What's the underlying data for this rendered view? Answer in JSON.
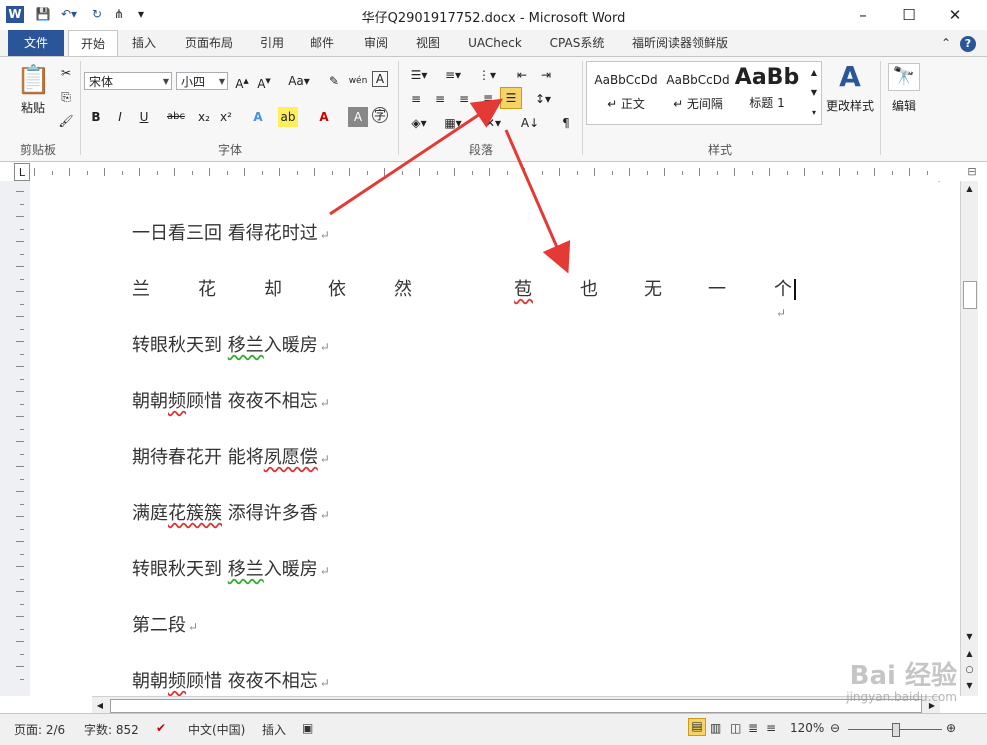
{
  "window": {
    "title": "华仔Q2901917752.docx - Microsoft Word",
    "app_icon": "W",
    "controls": {
      "help": "?"
    }
  },
  "tabs": [
    "文件",
    "开始",
    "插入",
    "页面布局",
    "引用",
    "邮件",
    "审阅",
    "视图",
    "UACheck",
    "CPAS系统",
    "福昕阅读器领鲜版"
  ],
  "active_tab": "开始",
  "ribbon": {
    "clipboard": {
      "paste": "粘贴",
      "group": "剪贴板"
    },
    "font": {
      "name": "宋体",
      "size": "小四",
      "group": "字体"
    },
    "paragraph": {
      "group": "段落"
    },
    "styles": {
      "items": [
        {
          "preview": "AaBbCcDd",
          "name": "↵ 正文"
        },
        {
          "preview": "AaBbCcDd",
          "name": "↵ 无间隔"
        },
        {
          "preview": "AaBb",
          "name": "标题 1"
        }
      ],
      "change_styles": "更改样式",
      "group": "样式"
    },
    "editing": {
      "label": "编辑"
    }
  },
  "document": {
    "lines": [
      {
        "text": "一日看三回  看得花时过"
      },
      {
        "text": "兰   花   却   依   然      苞   也   无   一   个"
      },
      {
        "text": "转眼秋天到  移兰入暖房"
      },
      {
        "text": "朝朝频顾惜  夜夜不相忘"
      },
      {
        "text": "期待春花开  能将夙愿偿"
      },
      {
        "text": "满庭花簇簇  添得许多香"
      },
      {
        "text": "转眼秋天到  移兰入暖房"
      },
      {
        "text": "第二段"
      },
      {
        "text": "朝朝频顾惜  夜夜不相忘"
      }
    ]
  },
  "status": {
    "page": "页面: 2/6",
    "words": "字数: 852",
    "lang": "中文(中国)",
    "mode": "插入",
    "zoom": "120%"
  },
  "watermark": {
    "brand": "Bai 经验",
    "url": "jingyan.baidu.com"
  },
  "colors": {
    "file_tab": "#2a5699",
    "arrow": "#e53935",
    "highlight": "#f6d365"
  }
}
